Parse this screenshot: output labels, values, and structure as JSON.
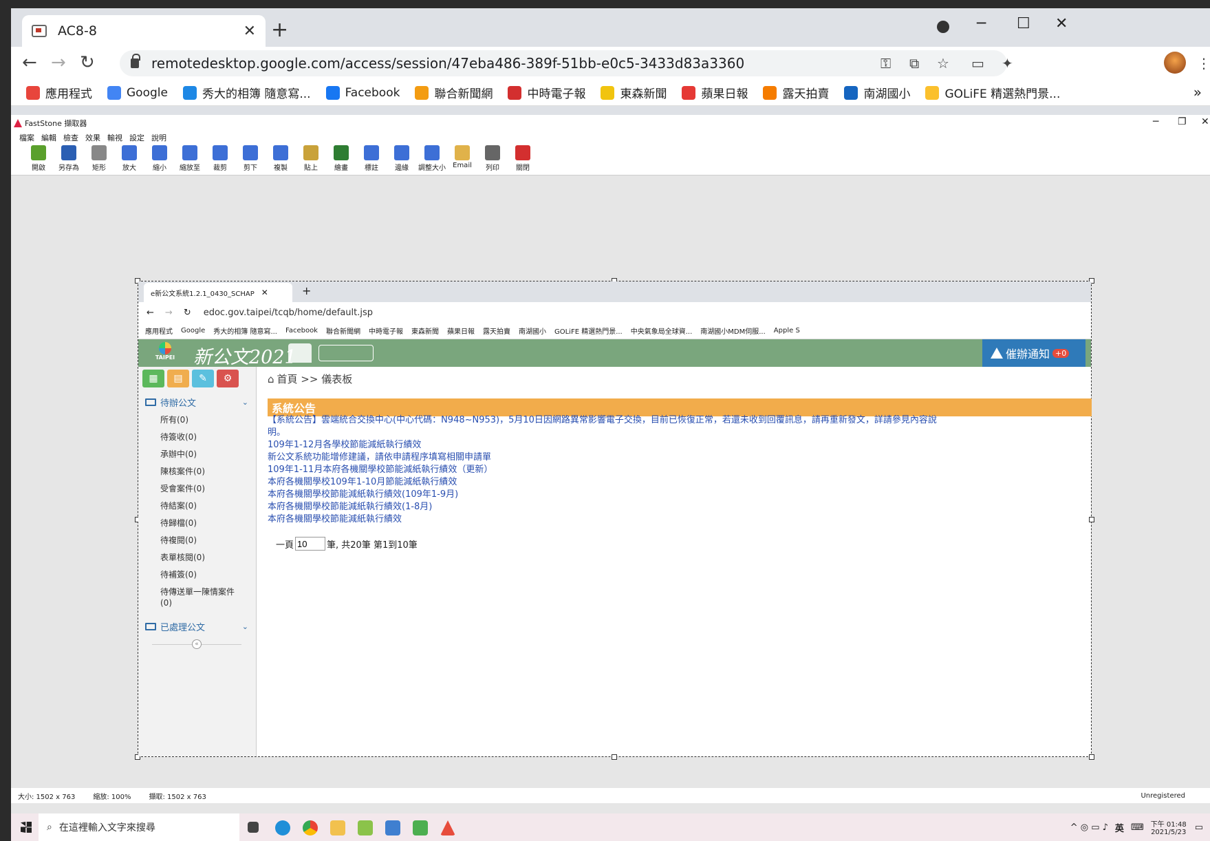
{
  "chrome": {
    "tab_title": "AC8-8",
    "url": "remotedesktop.google.com/access/session/47eba486-389f-51bb-e0c5-3433d83a3360",
    "bookmarks": [
      {
        "label": "應用程式",
        "color": "#e8453c"
      },
      {
        "label": "Google",
        "color": "#4285f4"
      },
      {
        "label": "秀大的相簿 隨意寫...",
        "color": "#1e88e5"
      },
      {
        "label": "Facebook",
        "color": "#1877f2"
      },
      {
        "label": "聯合新聞網",
        "color": "#f39c12"
      },
      {
        "label": "中時電子報",
        "color": "#d32f2f"
      },
      {
        "label": "東森新聞",
        "color": "#f1c40f"
      },
      {
        "label": "蘋果日報",
        "color": "#e53935"
      },
      {
        "label": "露天拍賣",
        "color": "#f57c00"
      },
      {
        "label": "南湖國小",
        "color": "#1565c0"
      },
      {
        "label": "GOLiFE 精選熱門景...",
        "color": "#fbc02d"
      }
    ]
  },
  "faststone": {
    "title": "FastStone 擷取器",
    "menu": [
      "檔案",
      "編輯",
      "檢查",
      "效果",
      "輸視",
      "設定",
      "說明"
    ],
    "toolbar": [
      {
        "label": "開啟",
        "color": "#5aa02c"
      },
      {
        "label": "另存為",
        "color": "#2b5fb3"
      },
      {
        "label": "矩形",
        "color": "#888"
      },
      {
        "label": "放大",
        "color": "#3d6fd6"
      },
      {
        "label": "縮小",
        "color": "#3d6fd6"
      },
      {
        "label": "縮放至",
        "color": "#3d6fd6"
      },
      {
        "label": "裁剪",
        "color": "#3d6fd6"
      },
      {
        "label": "剪下",
        "color": "#3d6fd6"
      },
      {
        "label": "複製",
        "color": "#3d6fd6"
      },
      {
        "label": "貼上",
        "color": "#c9a23a"
      },
      {
        "label": "繪畫",
        "color": "#2e7d32"
      },
      {
        "label": "標註",
        "color": "#3d6fd6"
      },
      {
        "label": "邊緣",
        "color": "#3d6fd6"
      },
      {
        "label": "調整大小",
        "color": "#3d6fd6"
      },
      {
        "label": "Email",
        "color": "#e0b24a"
      },
      {
        "label": "列印",
        "color": "#666"
      },
      {
        "label": "關閉",
        "color": "#d32f2f"
      }
    ],
    "status": [
      "大小: 1502 x 763",
      "縮放: 100%",
      "擷取: 1502 x 763"
    ],
    "unregistered": "Unregistered"
  },
  "inner": {
    "tab_title": "e新公文系統1.2.1_0430_SCHAP",
    "url": "edoc.gov.taipei/tcqb/home/default.jsp",
    "bookmarks": [
      "應用程式",
      "Google",
      "秀大的相簿 隨意寫...",
      "Facebook",
      "聯合新聞網",
      "中時電子報",
      "東森新聞",
      "蘋果日報",
      "露天拍賣",
      "南湖國小",
      "GOLiFE 精選熱門景...",
      "中央氣象局全球資...",
      "南湖國小MDM伺服...",
      "Apple S"
    ],
    "app_title": "新公文2021",
    "logo_text": "TAIPEI",
    "alert_label": "催辦通知",
    "alert_count": "+0",
    "breadcrumb": "首頁 >> 儀表板",
    "pending_header": "待辦公文",
    "pending_items": [
      "所有(0)",
      "待簽收(0)",
      "承辦中(0)",
      "陳核案件(0)",
      "受會案件(0)",
      "待結案(0)",
      "待歸檔(0)",
      "待複閱(0)",
      "表單核閱(0)",
      "待補簽(0)",
      "待傳送單一陳情案件",
      "(0)"
    ],
    "done_header": "已處理公文",
    "section_title": "系統公告",
    "announcements": [
      "【系統公告】雲端統合交換中心(中心代碼：N948~N953)，5月10日因網路異常影響電子交換，目前已恢復正常，若還未收到回覆訊息，請再重新發文，詳請參見內容說",
      "明。",
      "109年1-12月各學校節能減紙執行績效",
      "新公文系統功能增修建議，請依申請程序填寫相關申請單",
      "109年1-11月本府各機關學校節能減紙執行績效（更新）",
      "本府各機關學校109年1-10月節能減紙執行績效",
      "本府各機關學校節能減紙執行績效(109年1-9月)",
      "本府各機關學校節能減紙執行績效(1-8月)",
      "本府各機關學校節能減紙執行績效"
    ],
    "pager_prefix": "一頁",
    "pager_value": "10",
    "pager_suffix": "筆, 共20筆 第1到10筆"
  },
  "taskbar": {
    "search_placeholder": "在這裡輸入文字來搜尋",
    "ime": "英",
    "time": "下午 01:48",
    "date": "2021/5/23"
  }
}
